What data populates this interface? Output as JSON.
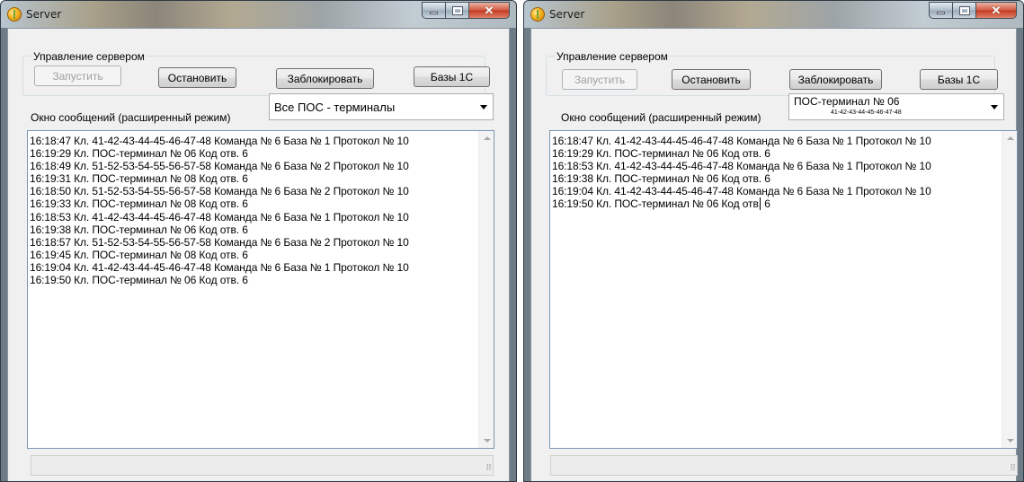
{
  "windows": [
    {
      "title": "Server",
      "group_label": "Управление сервером",
      "buttons": {
        "start": "Запустить",
        "stop": "Остановить",
        "block": "Заблокировать",
        "bases": "Базы 1С"
      },
      "messages_label": "Окно сообщений (расширенный режим)",
      "combo": {
        "selected": "Все ПОС - терминалы"
      },
      "log_lines": [
        "16:18:47 Кл. 41-42-43-44-45-46-47-48 Команда № 6 База № 1 Протокол № 10",
        "16:19:29 Кл. ПОС-терминал № 06 Код отв. 6",
        "16:18:49 Кл. 51-52-53-54-55-56-57-58 Команда № 6 База № 2 Протокол № 10",
        "16:19:31 Кл. ПОС-терминал № 08 Код отв. 6",
        "16:18:50 Кл. 51-52-53-54-55-56-57-58 Команда № 6 База № 2 Протокол № 10",
        "16:19:33 Кл. ПОС-терминал № 08 Код отв. 6",
        "16:18:53 Кл. 41-42-43-44-45-46-47-48 Команда № 6 База № 1 Протокол № 10",
        "16:19:38 Кл. ПОС-терминал № 06 Код отв. 6",
        "16:18:57 Кл. 51-52-53-54-55-56-57-58 Команда № 6 База № 2 Протокол № 10",
        "16:19:45 Кл. ПОС-терминал № 08 Код отв. 6",
        "16:19:04 Кл. 41-42-43-44-45-46-47-48 Команда № 6 База № 1 Протокол № 10",
        "16:19:50 Кл. ПОС-терминал № 06 Код отв. 6"
      ]
    },
    {
      "title": "Server",
      "group_label": "Управление сервером",
      "buttons": {
        "start": "Запустить",
        "stop": "Остановить",
        "block": "Заблокировать",
        "bases": "Базы 1С"
      },
      "messages_label": "Окно сообщений (расширенный режим)",
      "combo": {
        "selected": "ПОС-терминал № 06",
        "sub": "41-42-43-44-45-46-47-48"
      },
      "log_lines": [
        "16:18:47 Кл. 41-42-43-44-45-46-47-48 Команда № 6 База № 1 Протокол № 10",
        "16:19:29 Кл. ПОС-терминал № 06 Код отв. 6",
        "16:18:53 Кл. 41-42-43-44-45-46-47-48 Команда № 6 База № 1 Протокол № 10",
        "16:19:38 Кл. ПОС-терминал № 06 Код отв. 6",
        "16:19:04 Кл. 41-42-43-44-45-46-47-48 Команда № 6 База № 1 Протокол № 10",
        "16:19:50 Кл. ПОС-терминал № 06 Код отв. 6"
      ]
    }
  ],
  "icons": {
    "app": "app-icon",
    "minimize": "minimize-icon",
    "maximize": "maximize-icon",
    "close": "close-icon",
    "combo": "chevron-down-icon",
    "grip": "resize-grip-icon"
  },
  "colors": {
    "close_button": "#c13b21",
    "log_border": "#7a96b4",
    "window_bg": "#f0f0f0"
  }
}
